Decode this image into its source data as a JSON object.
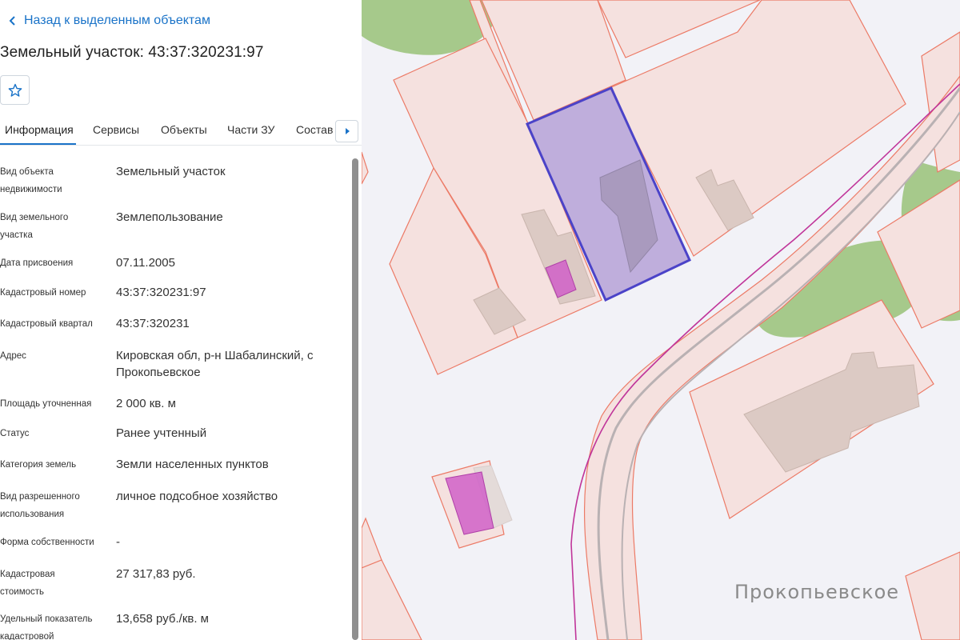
{
  "nav": {
    "back_label": "Назад к выделенным объектам"
  },
  "header": {
    "title": "Земельный участок: 43:37:320231:97"
  },
  "tabs": [
    {
      "label": "Информация",
      "active": true
    },
    {
      "label": "Сервисы"
    },
    {
      "label": "Объекты"
    },
    {
      "label": "Части ЗУ"
    },
    {
      "label": "Состав"
    }
  ],
  "info": [
    {
      "key": "Вид объекта\nнедвижимости",
      "value": "Земельный участок"
    },
    {
      "key": "Вид земельного\nучастка",
      "value": "Землепользование"
    },
    {
      "key": "Дата присвоения",
      "value": "07.11.2005"
    },
    {
      "key": "Кадастровый номер",
      "value": "43:37:320231:97"
    },
    {
      "key": "Кадастровый квартал",
      "value": "43:37:320231"
    },
    {
      "key": "Адрес",
      "value": "Кировская обл, р-н Шабалинский, с\nПрокопьевское"
    },
    {
      "key": "Площадь уточненная",
      "value": "2 000 кв. м"
    },
    {
      "key": "Статус",
      "value": "Ранее учтенный"
    },
    {
      "key": "Категория земель",
      "value": "Земли населенных пунктов"
    },
    {
      "key": "Вид разрешенного\nиспользования",
      "value": "личное подсобное хозяйство"
    },
    {
      "key": "Форма собственности",
      "value": "-"
    },
    {
      "key": "Кадастровая\nстоимость",
      "value": "27 317,83 руб."
    },
    {
      "key": "Удельный показатель\nкадастровой",
      "value": "13,658 руб./кв. м"
    }
  ],
  "map": {
    "place_label": "Прокопьевское"
  },
  "icons": {
    "back": "chevron-left-icon",
    "favorite": "star-icon",
    "tabs_next": "caret-right-icon"
  },
  "colors": {
    "accent": "#1a73c8",
    "parcel_fill": "#f5e1df",
    "parcel_stroke": "#ec7a66",
    "selected_fill": "#b9a6d8",
    "selected_stroke": "#4b43c8",
    "building": "#dccac4",
    "vegetation": "#a6c98b",
    "magenta": "#d060c8",
    "road_line": "#c0359a"
  }
}
